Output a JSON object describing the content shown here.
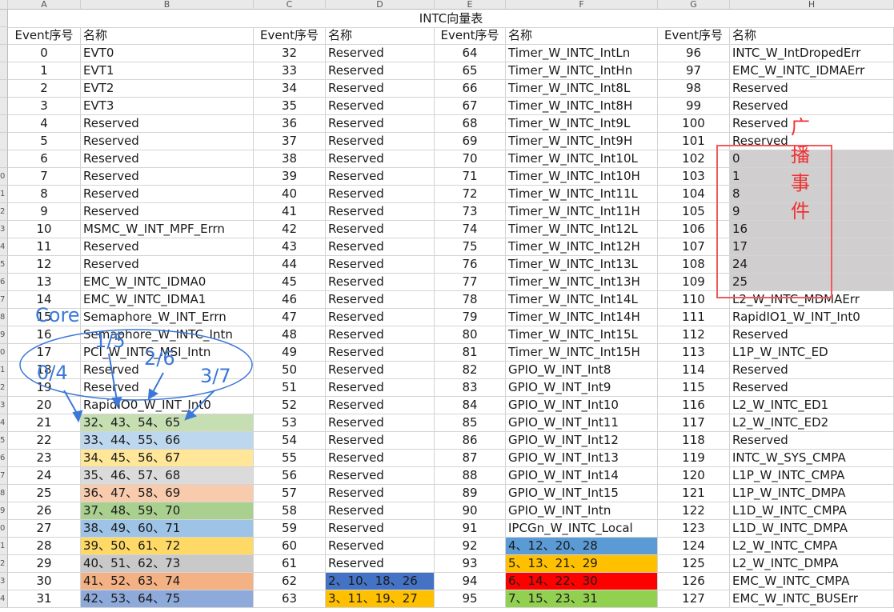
{
  "col_letters": [
    "A",
    "B",
    "C",
    "D",
    "E",
    "F",
    "G",
    "H"
  ],
  "sheet_title": "INTC向量表",
  "headers": [
    "Event序号",
    "名称",
    "Event序号",
    "名称",
    "Event序号",
    "名称",
    "Event序号",
    "名称"
  ],
  "row_numbers": [
    "",
    "",
    "",
    "",
    "",
    "",
    "",
    "",
    "",
    "0",
    "1",
    "2",
    "3",
    "4",
    "5",
    "6",
    "7",
    "8",
    "9",
    "0",
    "1",
    "2",
    "3",
    "4",
    "5",
    "6",
    "7",
    "8",
    "9",
    "0",
    "1",
    "2",
    "3",
    "4"
  ],
  "rows": [
    [
      "0",
      "EVT0",
      "32",
      "Reserved",
      "64",
      "Timer_W_INTC_IntLn",
      "96",
      "INTC_W_IntDropedErr"
    ],
    [
      "1",
      "EVT1",
      "33",
      "Reserved",
      "65",
      "Timer_W_INTC_IntHn",
      "97",
      "EMC_W_INTC_IDMAErr"
    ],
    [
      "2",
      "EVT2",
      "34",
      "Reserved",
      "66",
      "Timer_W_INTC_Int8L",
      "98",
      "Reserved"
    ],
    [
      "3",
      "EVT3",
      "35",
      "Reserved",
      "67",
      "Timer_W_INTC_Int8H",
      "99",
      "Reserved"
    ],
    [
      "4",
      "Reserved",
      "36",
      "Reserved",
      "68",
      "Timer_W_INTC_Int9L",
      "100",
      "Reserved"
    ],
    [
      "5",
      "Reserved",
      "37",
      "Reserved",
      "69",
      "Timer_W_INTC_Int9H",
      "101",
      "Reserved"
    ],
    [
      "6",
      "Reserved",
      "38",
      "Reserved",
      "70",
      "Timer_W_INTC_Int10L",
      "102",
      "0"
    ],
    [
      "7",
      "Reserved",
      "39",
      "Reserved",
      "71",
      "Timer_W_INTC_Int10H",
      "103",
      "1"
    ],
    [
      "8",
      "Reserved",
      "40",
      "Reserved",
      "72",
      "Timer_W_INTC_Int11L",
      "104",
      "8"
    ],
    [
      "9",
      "Reserved",
      "41",
      "Reserved",
      "73",
      "Timer_W_INTC_Int11H",
      "105",
      "9"
    ],
    [
      "10",
      "MSMC_W_INT_MPF_Errn",
      "42",
      "Reserved",
      "74",
      "Timer_W_INTC_Int12L",
      "106",
      "16"
    ],
    [
      "11",
      "Reserved",
      "43",
      "Reserved",
      "75",
      "Timer_W_INTC_Int12H",
      "107",
      "17"
    ],
    [
      "12",
      "Reserved",
      "44",
      "Reserved",
      "76",
      "Timer_W_INTC_Int13L",
      "108",
      "24"
    ],
    [
      "13",
      "EMC_W_INTC_IDMA0",
      "45",
      "Reserved",
      "77",
      "Timer_W_INTC_Int13H",
      "109",
      "25"
    ],
    [
      "14",
      "EMC_W_INTC_IDMA1",
      "46",
      "Reserved",
      "78",
      "Timer_W_INTC_Int14L",
      "110",
      "L2_W_INTC_MDMAErr"
    ],
    [
      "15",
      "Semaphore_W_INT_Errn",
      "47",
      "Reserved",
      "79",
      "Timer_W_INTC_Int14H",
      "111",
      "RapidIO1_W_INT_Int0"
    ],
    [
      "16",
      "Semaphore_W_INTC_Intn",
      "48",
      "Reserved",
      "80",
      "Timer_W_INTC_Int15L",
      "112",
      "Reserved"
    ],
    [
      "17",
      "PCI_W_INTC_MSI_Intn",
      "49",
      "Reserved",
      "81",
      "Timer_W_INTC_Int15H",
      "113",
      "L1P_W_INTC_ED"
    ],
    [
      "18",
      "Reserved",
      "50",
      "Reserved",
      "82",
      "GPIO_W_INT_Int8",
      "114",
      "Reserved"
    ],
    [
      "19",
      "Reserved",
      "51",
      "Reserved",
      "83",
      "GPIO_W_INT_Int9",
      "115",
      "Reserved"
    ],
    [
      "20",
      "RapidIO0_W_INT_Int0",
      "52",
      "Reserved",
      "84",
      "GPIO_W_INT_Int10",
      "116",
      "L2_W_INTC_ED1"
    ],
    [
      "21",
      "32、43、54、65",
      "53",
      "Reserved",
      "85",
      "GPIO_W_INT_Int11",
      "117",
      "L2_W_INTC_ED2"
    ],
    [
      "22",
      "33、44、55、66",
      "54",
      "Reserved",
      "86",
      "GPIO_W_INT_Int12",
      "118",
      "Reserved"
    ],
    [
      "23",
      "34、45、56、67",
      "55",
      "Reserved",
      "87",
      "GPIO_W_INT_Int13",
      "119",
      "INTC_W_SYS_CMPA"
    ],
    [
      "24",
      "35、46、57、68",
      "56",
      "Reserved",
      "88",
      "GPIO_W_INT_Int14",
      "120",
      "L1P_W_INTC_CMPA"
    ],
    [
      "25",
      "36、47、58、69",
      "57",
      "Reserved",
      "89",
      "GPIO_W_INT_Int15",
      "121",
      "L1P_W_INTC_DMPA"
    ],
    [
      "26",
      "37、48、59、70",
      "58",
      "Reserved",
      "90",
      "GPIO_W_INT_Intn",
      "122",
      "L1D_W_INTC_CMPA"
    ],
    [
      "27",
      "38、49、60、71",
      "59",
      "Reserved",
      "91",
      "IPCGn_W_INTC_Local",
      "123",
      "L1D_W_INTC_DMPA"
    ],
    [
      "28",
      "39、50、61、72",
      "60",
      "Reserved",
      "92",
      "4、12、20、28",
      "124",
      "L2_W_INTC_CMPA"
    ],
    [
      "29",
      "40、51、62、73",
      "61",
      "Reserved",
      "93",
      "5、13、21、29",
      "125",
      "L2_W_INTC_DMPA"
    ],
    [
      "30",
      "41、52、63、74",
      "62",
      "2、10、18、26",
      "94",
      "6、14、22、30",
      "126",
      "EMC_W_INTC_CMPA"
    ],
    [
      "31",
      "42、53、64、75",
      "63",
      "3、11、19、27",
      "95",
      "7、15、23、31",
      "127",
      "EMC_W_INTC_BUSErr"
    ]
  ],
  "fills": {
    "B21": "#c5dfb3",
    "B22": "#bdd7ee",
    "B23": "#ffe699",
    "B24": "#dbdbdb",
    "B25": "#f8cbad",
    "B26": "#a9d08e",
    "B27": "#9dc3e6",
    "B28": "#ffd966",
    "B29": "#c9c9c9",
    "B30": "#f4b183",
    "B31": "#8eaadb",
    "D30": "#4472c4",
    "D31": "#ffc000",
    "F28": "#5b9bd5",
    "F29": "#ffc000",
    "F30": "#ff0000",
    "F31": "#92d050",
    "H6": "#d0cece",
    "H7": "#d0cece",
    "H8": "#d0cece",
    "H9": "#d0cece",
    "H10": "#d0cece",
    "H11": "#d0cece",
    "H12": "#d0cece",
    "H13": "#d0cece"
  },
  "annotations": {
    "broadcast_label": "广播事件",
    "core_label": "Core",
    "core_groups": [
      "0/4",
      "1/5",
      "2/6",
      "3/7"
    ]
  }
}
